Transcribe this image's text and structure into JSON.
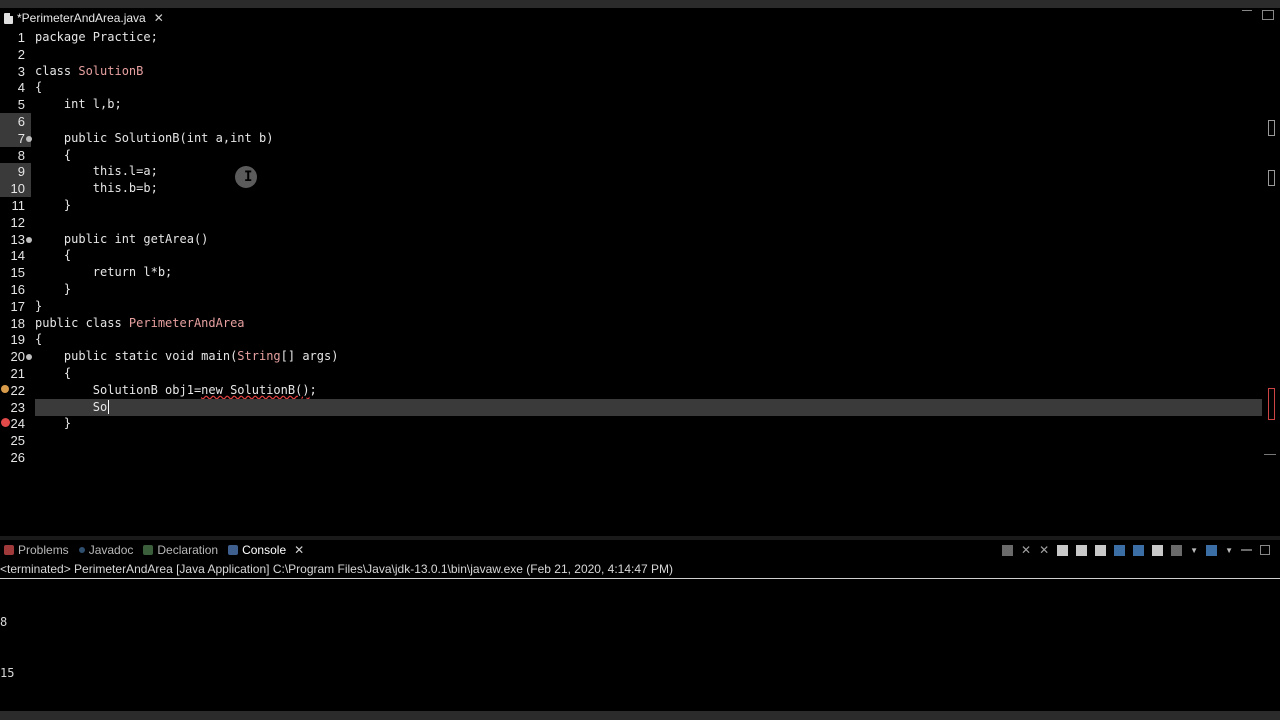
{
  "editor": {
    "tab_title": "*PerimeterAndArea.java",
    "current_line_number": "23",
    "lines": [
      {
        "n": "1",
        "parts": [
          [
            "kw",
            "package Practice;"
          ]
        ]
      },
      {
        "n": "2",
        "parts": []
      },
      {
        "n": "3",
        "parts": [
          [
            "kw",
            "class "
          ],
          [
            "cls",
            "SolutionB"
          ]
        ]
      },
      {
        "n": "4",
        "parts": [
          [
            "kw",
            "{"
          ]
        ]
      },
      {
        "n": "5",
        "parts": [
          [
            "kw",
            "    int l,b;"
          ]
        ]
      },
      {
        "n": "6",
        "parts": []
      },
      {
        "n": "7",
        "parts": [
          [
            "kw",
            "    public SolutionB(int a,int b)"
          ]
        ]
      },
      {
        "n": "8",
        "parts": [
          [
            "kw",
            "    {"
          ]
        ]
      },
      {
        "n": "9",
        "parts": [
          [
            "kw",
            "        this.l=a;"
          ]
        ]
      },
      {
        "n": "10",
        "parts": [
          [
            "kw",
            "        this.b=b;"
          ]
        ]
      },
      {
        "n": "11",
        "parts": [
          [
            "kw",
            "    }"
          ]
        ]
      },
      {
        "n": "12",
        "parts": []
      },
      {
        "n": "13",
        "parts": [
          [
            "kw",
            "    public int getArea()"
          ]
        ]
      },
      {
        "n": "14",
        "parts": [
          [
            "kw",
            "    {"
          ]
        ]
      },
      {
        "n": "15",
        "parts": [
          [
            "kw",
            "        return l*b;"
          ]
        ]
      },
      {
        "n": "16",
        "parts": [
          [
            "kw",
            "    }"
          ]
        ]
      },
      {
        "n": "17",
        "parts": [
          [
            "kw",
            "}"
          ]
        ]
      },
      {
        "n": "18",
        "parts": [
          [
            "kw",
            "public class "
          ],
          [
            "cls",
            "PerimeterAndArea"
          ]
        ]
      },
      {
        "n": "19",
        "parts": [
          [
            "kw",
            "{"
          ]
        ]
      },
      {
        "n": "20",
        "parts": [
          [
            "kw",
            "    public static void main("
          ],
          [
            "cls",
            "String"
          ],
          [
            "kw",
            "[] args)"
          ]
        ]
      },
      {
        "n": "21",
        "parts": [
          [
            "kw",
            "    {"
          ]
        ]
      },
      {
        "n": "22",
        "parts": [
          [
            "kw",
            "        SolutionB obj1="
          ],
          [
            "err",
            "new SolutionB()"
          ],
          [
            "kw",
            ";"
          ]
        ]
      },
      {
        "n": "23",
        "parts": [
          [
            "kw",
            "        So"
          ]
        ]
      },
      {
        "n": "24",
        "parts": [
          [
            "kw",
            "    }"
          ]
        ]
      },
      {
        "n": "25",
        "parts": []
      },
      {
        "n": "26",
        "parts": []
      }
    ]
  },
  "views": {
    "tabs": [
      {
        "label": "Problems",
        "icon": "problems-icon"
      },
      {
        "label": "Javadoc",
        "icon": "javadoc-icon"
      },
      {
        "label": "Declaration",
        "icon": "declaration-icon"
      },
      {
        "label": "Console",
        "icon": "console-icon",
        "active": true
      }
    ]
  },
  "console": {
    "status": "<terminated> PerimeterAndArea [Java Application] C:\\Program Files\\Java\\jdk-13.0.1\\bin\\javaw.exe (Feb 21, 2020, 4:14:47 PM)",
    "output": [
      "8",
      "15"
    ]
  },
  "colors": {
    "background": "#000000",
    "class_name": "#e7a0a0",
    "current_line": "#3a3a3a",
    "error": "#e24a4a"
  }
}
